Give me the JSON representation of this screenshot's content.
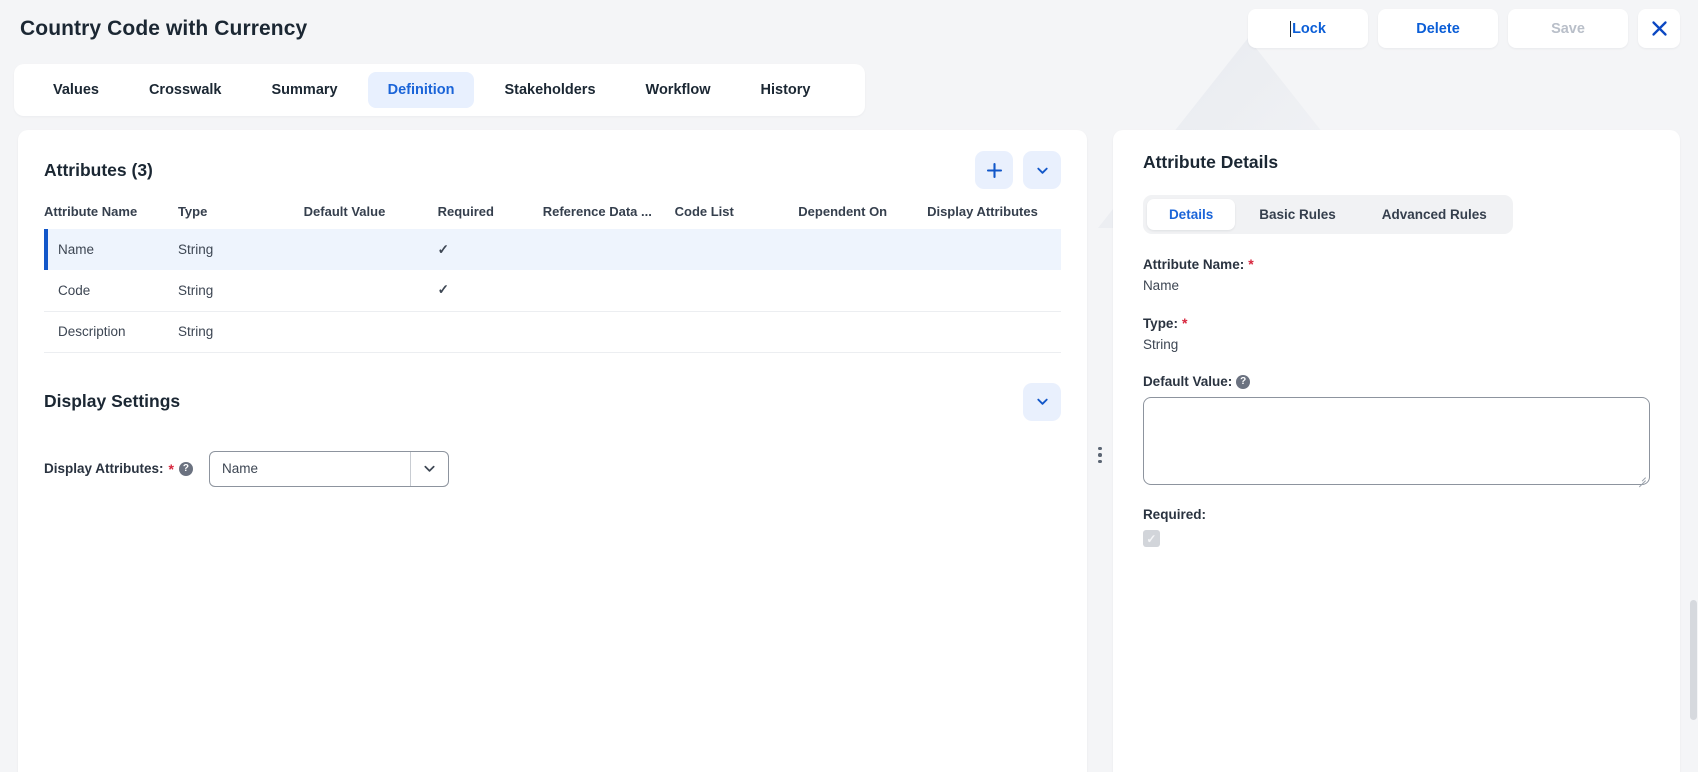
{
  "header": {
    "title": "Country Code with Currency",
    "actions": [
      {
        "label": "Lock",
        "state": "focused"
      },
      {
        "label": "Delete",
        "state": "normal"
      },
      {
        "label": "Save",
        "state": "disabled"
      }
    ],
    "close_icon": "close-icon"
  },
  "tabs": [
    {
      "label": "Values",
      "active": false
    },
    {
      "label": "Crosswalk",
      "active": false
    },
    {
      "label": "Summary",
      "active": false
    },
    {
      "label": "Definition",
      "active": true
    },
    {
      "label": "Stakeholders",
      "active": false
    },
    {
      "label": "Workflow",
      "active": false
    },
    {
      "label": "History",
      "active": false
    }
  ],
  "attributes_panel": {
    "title": "Attributes (3)",
    "add_icon": "plus-icon",
    "collapse_icon": "chevron-down-icon",
    "columns": [
      "Attribute Name",
      "Type",
      "Default Value",
      "Required",
      "Reference Data ...",
      "Code List",
      "Dependent On",
      "Display Attributes"
    ],
    "rows": [
      {
        "name": "Name",
        "type": "String",
        "default_value": "",
        "required": "✓",
        "reference_data": "",
        "code_list": "",
        "dependent_on": "",
        "display_attributes": "",
        "selected": true
      },
      {
        "name": "Code",
        "type": "String",
        "default_value": "",
        "required": "✓",
        "reference_data": "",
        "code_list": "",
        "dependent_on": "",
        "display_attributes": "",
        "selected": false
      },
      {
        "name": "Description",
        "type": "String",
        "default_value": "",
        "required": "",
        "reference_data": "",
        "code_list": "",
        "dependent_on": "",
        "display_attributes": "",
        "selected": false
      }
    ]
  },
  "display_settings": {
    "title": "Display Settings",
    "collapse_icon": "chevron-down-icon",
    "field_label": "Display Attributes:",
    "required_marker": "*",
    "help_icon": "help-icon",
    "selected_value": "Name",
    "dropdown_icon": "chevron-down-icon"
  },
  "attribute_details": {
    "title": "Attribute Details",
    "tabs": [
      {
        "label": "Details",
        "active": true
      },
      {
        "label": "Basic Rules",
        "active": false
      },
      {
        "label": "Advanced Rules",
        "active": false
      }
    ],
    "fields": {
      "attribute_name_label": "Attribute Name:",
      "attribute_name_value": "Name",
      "type_label": "Type:",
      "type_value": "String",
      "default_value_label": "Default Value:",
      "default_value_text": "",
      "required_label": "Required:",
      "required_checked": "✓"
    },
    "required_marker": "*",
    "help_icon": "help-icon"
  },
  "splitter": {
    "handle_icon": "drag-handle-icon"
  },
  "colors": {
    "accent_blue": "#1257c9",
    "link_blue": "#0b5ed7",
    "tab_active_bg": "#e8f0fe",
    "selected_row_bg": "#eef4fd",
    "page_bg": "#f4f5f7",
    "required_red": "#d7263d",
    "disabled_gray": "#b9bfc9"
  }
}
